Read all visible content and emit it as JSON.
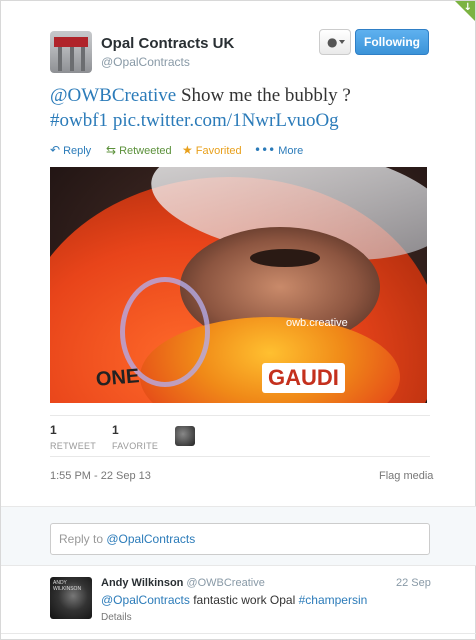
{
  "tweet": {
    "author_name": "Opal Contracts UK",
    "author_handle": "@OpalContracts",
    "follow_button": "Following",
    "text_mention": "@OWBCreative",
    "text_body": " Show me the bubbly ?",
    "text_hashtag": "#owbf1",
    "text_link": " pic.twitter.com/1NwrLvuoOg",
    "actions": {
      "reply": "Reply",
      "retweet": "Retweeted",
      "favorite": "Favorited",
      "more": "More"
    },
    "media_labels": {
      "sponsor_big": "GAUDI",
      "sponsor_small": "owb.creative",
      "sponsor_one": "ONE"
    },
    "stats": {
      "retweets_count": "1",
      "retweets_label": "RETWEET",
      "favorites_count": "1",
      "favorites_label": "FAVORITE"
    },
    "timestamp": "1:55 PM - 22 Sep 13",
    "flag_media": "Flag media"
  },
  "reply_box": {
    "placeholder_prefix": "Reply to ",
    "placeholder_mention": "@OpalContracts"
  },
  "reply_tweet": {
    "author_name": "Andy Wilkinson",
    "author_handle": "@OWBCreative",
    "date": "22 Sep",
    "mention": "@OpalContracts",
    "body": " fantastic work Opal ",
    "hashtag": "#champersin",
    "details": "Details"
  },
  "colors": {
    "link": "#2b7bb9",
    "retweeted": "#5c913b",
    "favorited": "#e8a01c",
    "follow_button": "#3b93d8"
  },
  "icons": {
    "reply": "reply-arrow-icon",
    "retweet": "retweet-icon",
    "favorite": "star-icon",
    "more": "more-dots-icon",
    "user_menu": "person-icon"
  }
}
